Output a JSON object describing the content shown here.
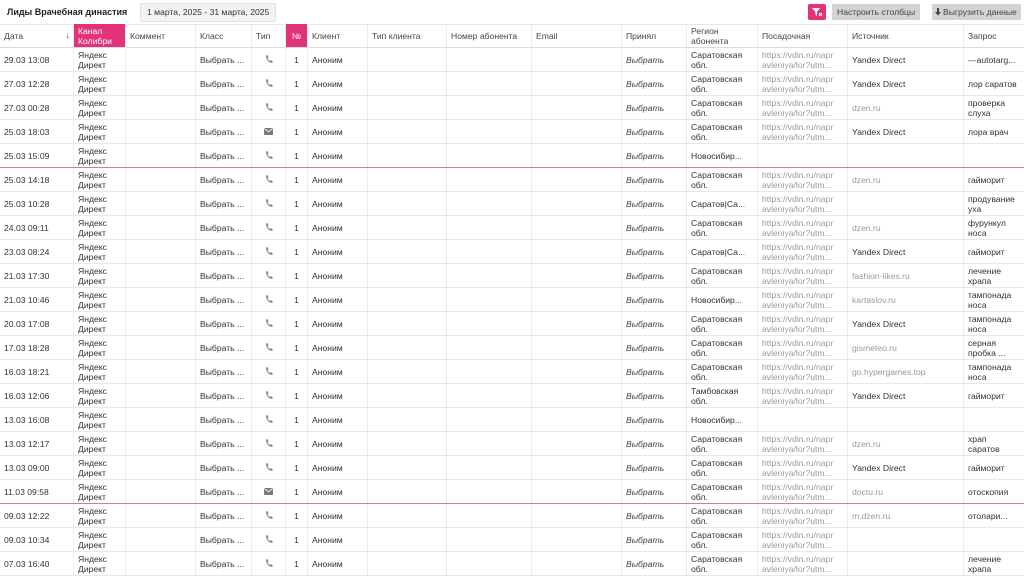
{
  "header": {
    "title": "Лиды Врачебная династия",
    "date_range": "1 марта, 2025 - 31 марта, 2025",
    "configure_label": "Настроить столбцы",
    "export_label": "Выгрузить данные"
  },
  "columns": {
    "date": "Дата",
    "channel": "Канал Колибри",
    "comment": "Коммент",
    "class": "Класс",
    "type": "Тип",
    "num": "№",
    "client": "Клиент",
    "client_type": "Тип клиента",
    "phone": "Номер абонента",
    "email": "Email",
    "accepted": "Принял",
    "region": "Регион абонента",
    "landing": "Посадочная",
    "source": "Источник",
    "query": "Запрос"
  },
  "rows": [
    {
      "date": "29.03 13:08",
      "channel": "Яндекс Директ",
      "class": "Выбрать ...",
      "type": "phone",
      "num": "1",
      "client": "Аноним",
      "accepted": "Выбрать",
      "region": "Саратовская обл.",
      "landing": "https://vdin.ru/napr avleniya/lor?utm...",
      "source": "Yandex Direct",
      "source_dark": true,
      "query": "---autotarg..."
    },
    {
      "date": "27.03 12:28",
      "channel": "Яндекс Директ",
      "class": "Выбрать ...",
      "type": "phone",
      "num": "1",
      "client": "Аноним",
      "accepted": "Выбрать",
      "region": "Саратовская обл.",
      "landing": "https://vdin.ru/napr avleniya/lor?utm...",
      "source": "Yandex Direct",
      "source_dark": true,
      "query": "лор саратов"
    },
    {
      "date": "27.03 00:28",
      "channel": "Яндекс Директ",
      "class": "Выбрать ...",
      "type": "phone",
      "num": "1",
      "client": "Аноним",
      "accepted": "Выбрать",
      "region": "Саратовская обл.",
      "landing": "https://vdin.ru/napr avleniya/lor?utm...",
      "source": "dzen.ru",
      "source_dark": false,
      "query": "проверка слуха"
    },
    {
      "date": "25.03 18:03",
      "channel": "Яндекс Директ",
      "class": "Выбрать ...",
      "type": "mail",
      "num": "1",
      "client": "Аноним",
      "accepted": "Выбрать",
      "region": "Саратовская обл.",
      "landing": "https://vdin.ru/napr avleniya/lor?utm...",
      "source": "Yandex Direct",
      "source_dark": true,
      "query": "лора врач"
    },
    {
      "date": "25.03 15:09",
      "channel": "Яндекс Директ",
      "class": "Выбрать ...",
      "type": "phone",
      "num": "1",
      "client": "Аноним",
      "accepted": "Выбрать",
      "region": "Новосибир...",
      "landing": "",
      "source": "",
      "source_dark": false,
      "query": ""
    },
    {
      "date": "25.03 14:18",
      "channel": "Яндекс Директ",
      "class": "Выбрать ...",
      "type": "phone",
      "num": "1",
      "client": "Аноним",
      "accepted": "Выбрать",
      "region": "Саратовская обл.",
      "landing": "https://vdin.ru/napr avleniya/lor?utm...",
      "source": "dzen.ru",
      "source_dark": false,
      "query": "гайморит"
    },
    {
      "date": "25.03 10:28",
      "channel": "Яндекс Директ",
      "class": "Выбрать ...",
      "type": "phone",
      "num": "1",
      "client": "Аноним",
      "accepted": "Выбрать",
      "region": "Саратов|Са...",
      "landing": "https://vdin.ru/napr avleniya/lor?utm...",
      "source": "",
      "source_dark": false,
      "query": "продувание уха"
    },
    {
      "date": "24.03 09:11",
      "channel": "Яндекс Директ",
      "class": "Выбрать ...",
      "type": "phone",
      "num": "1",
      "client": "Аноним",
      "accepted": "Выбрать",
      "region": "Саратовская обл.",
      "landing": "https://vdin.ru/napr avleniya/lor?utm...",
      "source": "dzen.ru",
      "source_dark": false,
      "query": "фурункул носа"
    },
    {
      "date": "23.03 08:24",
      "channel": "Яндекс Директ",
      "class": "Выбрать ...",
      "type": "phone",
      "num": "1",
      "client": "Аноним",
      "accepted": "Выбрать",
      "region": "Саратов|Са...",
      "landing": "https://vdin.ru/napr avleniya/lor?utm...",
      "source": "Yandex Direct",
      "source_dark": true,
      "query": "гайморит"
    },
    {
      "date": "21.03 17:30",
      "channel": "Яндекс Директ",
      "class": "Выбрать ...",
      "type": "phone",
      "num": "1",
      "client": "Аноним",
      "accepted": "Выбрать",
      "region": "Саратовская обл.",
      "landing": "https://vdin.ru/napr avleniya/lor?utm...",
      "source": "fashion-likes.ru",
      "source_dark": false,
      "query": "лечение храпа"
    },
    {
      "date": "21.03 10:46",
      "channel": "Яндекс Директ",
      "class": "Выбрать ...",
      "type": "phone",
      "num": "1",
      "client": "Аноним",
      "accepted": "Выбрать",
      "region": "Новосибир...",
      "landing": "https://vdin.ru/napr avleniya/lor?utm...",
      "source": "kartaslov.ru",
      "source_dark": false,
      "query": "тампонада носа"
    },
    {
      "date": "20.03 17:08",
      "channel": "Яндекс Директ",
      "class": "Выбрать ...",
      "type": "phone",
      "num": "1",
      "client": "Аноним",
      "accepted": "Выбрать",
      "region": "Саратовская обл.",
      "landing": "https://vdin.ru/napr avleniya/lor?utm...",
      "source": "Yandex Direct",
      "source_dark": true,
      "query": "тампонада носа"
    },
    {
      "date": "17.03 18:28",
      "channel": "Яндекс Директ",
      "class": "Выбрать ...",
      "type": "phone",
      "num": "1",
      "client": "Аноним",
      "accepted": "Выбрать",
      "region": "Саратовская обл.",
      "landing": "https://vdin.ru/napr avleniya/lor?utm...",
      "source": "gismeteo.ru",
      "source_dark": false,
      "query": "серная пробка ..."
    },
    {
      "date": "16.03 18:21",
      "channel": "Яндекс Директ",
      "class": "Выбрать ...",
      "type": "phone",
      "num": "1",
      "client": "Аноним",
      "accepted": "Выбрать",
      "region": "Саратовская обл.",
      "landing": "https://vdin.ru/napr avleniya/lor?utm...",
      "source": "go.hypergames.top",
      "source_dark": false,
      "query": "тампонада носа"
    },
    {
      "date": "16.03 12:06",
      "channel": "Яндекс Директ",
      "class": "Выбрать ...",
      "type": "phone",
      "num": "1",
      "client": "Аноним",
      "accepted": "Выбрать",
      "region": "Тамбовская обл.",
      "landing": "https://vdin.ru/napr avleniya/lor?utm...",
      "source": "Yandex Direct",
      "source_dark": true,
      "query": "гайморит"
    },
    {
      "date": "13.03 16:08",
      "channel": "Яндекс Директ",
      "class": "Выбрать ...",
      "type": "phone",
      "num": "1",
      "client": "Аноним",
      "accepted": "Выбрать",
      "region": "Новосибир...",
      "landing": "",
      "source": "",
      "source_dark": false,
      "query": ""
    },
    {
      "date": "13.03 12:17",
      "channel": "Яндекс Директ",
      "class": "Выбрать ...",
      "type": "phone",
      "num": "1",
      "client": "Аноним",
      "accepted": "Выбрать",
      "region": "Саратовская обл.",
      "landing": "https://vdin.ru/napr avleniya/lor?utm...",
      "source": "dzen.ru",
      "source_dark": false,
      "query": "храп саратов"
    },
    {
      "date": "13.03 09:00",
      "channel": "Яндекс Директ",
      "class": "Выбрать ...",
      "type": "phone",
      "num": "1",
      "client": "Аноним",
      "accepted": "Выбрать",
      "region": "Саратовская обл.",
      "landing": "https://vdin.ru/napr avleniya/lor?utm...",
      "source": "Yandex Direct",
      "source_dark": true,
      "query": "гайморит"
    },
    {
      "date": "11.03 09:58",
      "channel": "Яндекс Директ",
      "class": "Выбрать ...",
      "type": "mail",
      "num": "1",
      "client": "Аноним",
      "accepted": "Выбрать",
      "region": "Саратовская обл.",
      "landing": "https://vdin.ru/napr avleniya/lor?utm...",
      "source": "doctu.ru",
      "source_dark": false,
      "query": "отоскопия"
    },
    {
      "date": "09.03 12:22",
      "channel": "Яндекс Директ",
      "class": "Выбрать ...",
      "type": "phone",
      "num": "1",
      "client": "Аноним",
      "accepted": "Выбрать",
      "region": "Саратовская обл.",
      "landing": "https://vdin.ru/napr avleniya/lor?utm...",
      "source": "m.dzen.ru",
      "source_dark": false,
      "query": "отолари..."
    },
    {
      "date": "09.03 10:34",
      "channel": "Яндекс Директ",
      "class": "Выбрать ...",
      "type": "phone",
      "num": "1",
      "client": "Аноним",
      "accepted": "Выбрать",
      "region": "Саратовская обл.",
      "landing": "https://vdin.ru/napr avleniya/lor?utm...",
      "source": "",
      "source_dark": false,
      "query": ""
    },
    {
      "date": "07.03 16:40",
      "channel": "Яндекс Директ",
      "class": "Выбрать ...",
      "type": "phone",
      "num": "1",
      "client": "Аноним",
      "accepted": "Выбрать",
      "region": "Саратовская обл.",
      "landing": "https://vdin.ru/napr avleniya/lor?utm...",
      "source": "",
      "source_dark": false,
      "query": "лечение храпа"
    }
  ],
  "colors": {
    "accent": "#e2327a",
    "highlight_border": "#e07a8a",
    "button_grey": "#d3d3d3"
  }
}
